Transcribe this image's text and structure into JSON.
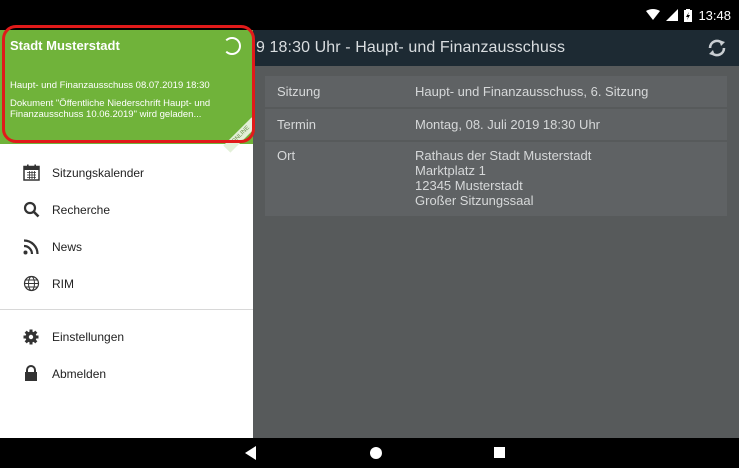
{
  "status_bar": {
    "time": "13:48"
  },
  "app": {
    "toolbar_title": "9 18:30 Uhr - Haupt- und Finanzausschuss",
    "details": [
      {
        "key": "Sitzung",
        "value": "Haupt- und Finanzausschuss, 6. Sitzung"
      },
      {
        "key": "Termin",
        "value": "Montag, 08. Juli 2019 18:30 Uhr"
      },
      {
        "key": "Ort",
        "lines": [
          "Rathaus der Stadt Musterstadt",
          "Marktplatz 1",
          "12345 Musterstadt",
          "Großer Sitzungssaal"
        ]
      }
    ]
  },
  "drawer": {
    "header": {
      "title": "Stadt Musterstadt",
      "line1": "Haupt- und Finanzausschuss 08.07.2019 18:30",
      "line2": "Dokument \"Öffentliche Niederschrift Haupt- und Finanzausschuss 10.06.2019\" wird geladen...",
      "corner_badge": "ONLINE",
      "color": "#70b33a"
    },
    "menu": [
      {
        "label": "Sitzungskalender",
        "icon": "calendar-icon"
      },
      {
        "label": "Recherche",
        "icon": "search-icon"
      },
      {
        "label": "News",
        "icon": "rss-icon"
      },
      {
        "label": "RIM",
        "icon": "globe-icon"
      }
    ],
    "menu2": [
      {
        "label": "Einstellungen",
        "icon": "gear-icon"
      },
      {
        "label": "Abmelden",
        "icon": "lock-icon"
      }
    ]
  },
  "highlight_color": "#e11a1a"
}
